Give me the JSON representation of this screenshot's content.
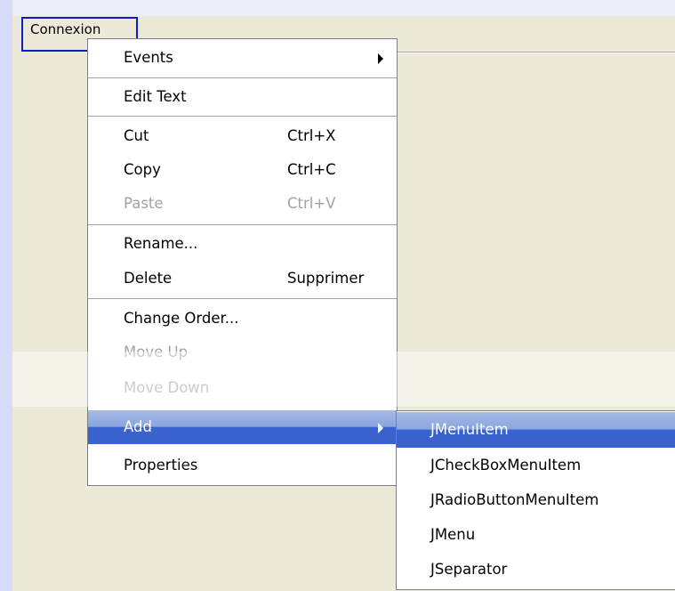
{
  "menubar": {
    "menu_label": "Connexion"
  },
  "context_menu": {
    "items": [
      {
        "label": "Events",
        "shortcut": "",
        "submenu": true,
        "enabled": true
      },
      {
        "label": "Edit Text",
        "shortcut": "",
        "submenu": false,
        "enabled": true
      },
      {
        "label": "Cut",
        "shortcut": "Ctrl+X",
        "submenu": false,
        "enabled": true
      },
      {
        "label": "Copy",
        "shortcut": "Ctrl+C",
        "submenu": false,
        "enabled": true
      },
      {
        "label": "Paste",
        "shortcut": "Ctrl+V",
        "submenu": false,
        "enabled": false
      },
      {
        "label": "Rename...",
        "shortcut": "",
        "submenu": false,
        "enabled": true
      },
      {
        "label": "Delete",
        "shortcut": "Supprimer",
        "submenu": false,
        "enabled": true
      },
      {
        "label": "Change Order...",
        "shortcut": "",
        "submenu": false,
        "enabled": true
      },
      {
        "label": "Move Up",
        "shortcut": "",
        "submenu": false,
        "enabled": false
      },
      {
        "label": "Move Down",
        "shortcut": "",
        "submenu": false,
        "enabled": false
      },
      {
        "label": "Add",
        "shortcut": "",
        "submenu": true,
        "enabled": true,
        "selected": true
      },
      {
        "label": "Properties",
        "shortcut": "",
        "submenu": false,
        "enabled": true
      }
    ]
  },
  "add_submenu": {
    "items": [
      {
        "label": "JMenuItem",
        "selected": true
      },
      {
        "label": "JCheckBoxMenuItem"
      },
      {
        "label": "JRadioButtonMenuItem"
      },
      {
        "label": "JMenu"
      },
      {
        "label": "JSeparator"
      }
    ]
  },
  "colors": {
    "selection": "#3a62cf",
    "menu_border_highlight": "#0f1dbf",
    "canvas": "#ece9d8",
    "disabled_text": "#a2a2a2"
  }
}
